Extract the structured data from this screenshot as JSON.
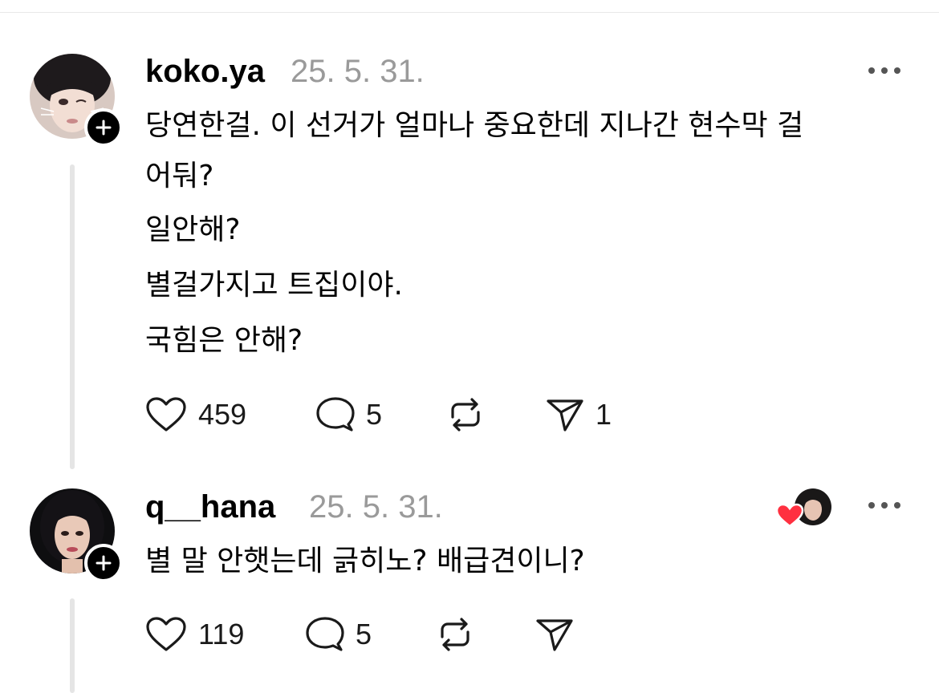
{
  "posts": [
    {
      "username": "koko.ya",
      "date": "25. 5. 31.",
      "lines": [
        "당연한걸. 이 선거가 얼마나 중요한데 지나간 현수막 걸",
        "어둬?",
        "일안해?",
        "별걸가지고 트집이야.",
        "국힘은 안해?"
      ],
      "likes": "459",
      "replies": "5",
      "shares": "1"
    },
    {
      "username": "q__hana",
      "date": "25. 5. 31.",
      "lines": [
        "별 말 안햇는데 긁히노? 배급견이니?"
      ],
      "likes": "119",
      "replies": "5"
    }
  ],
  "colors": {
    "date_gray": "#9a9a9a",
    "thread_line": "#e5e5e5",
    "heart_red": "#ff3040"
  },
  "icons": [
    "more-icon",
    "plus-icon",
    "heart-icon",
    "comment-icon",
    "repost-icon",
    "send-icon"
  ]
}
